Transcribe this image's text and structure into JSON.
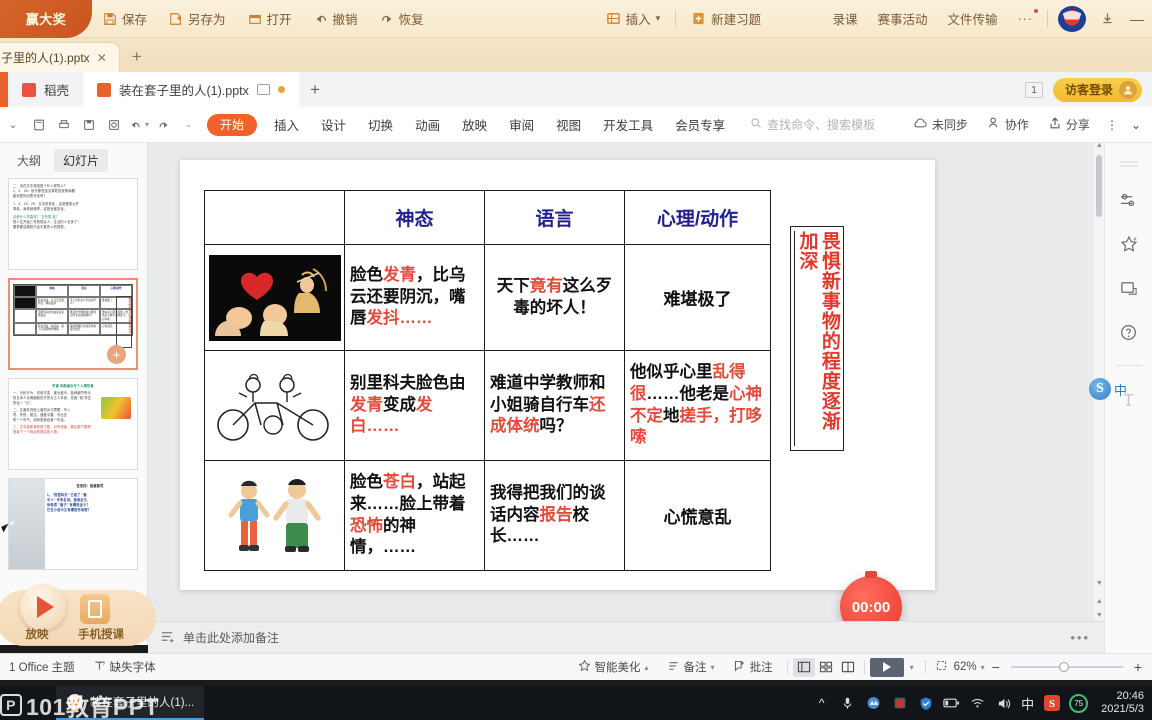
{
  "topbar": {
    "promo": "赢大奖",
    "items": [
      {
        "label": "保存",
        "icon": "save-icon"
      },
      {
        "label": "另存为",
        "icon": "save-as-icon"
      },
      {
        "label": "打开",
        "icon": "open-folder-icon"
      },
      {
        "label": "撤销",
        "icon": "undo-arrow-icon"
      },
      {
        "label": "恢复",
        "icon": "redo-arrow-icon"
      }
    ],
    "insert": {
      "label": "插入",
      "icon": "insert-icon",
      "caret": "▾"
    },
    "new_exercise": {
      "label": "新建习题",
      "icon": "new-exercise-icon"
    },
    "plain_items": [
      "录课",
      "赛事活动",
      "文件传输"
    ],
    "more": "···",
    "minimize": "—"
  },
  "tabstrip": {
    "doc_tab": "子里的人(1).pptx",
    "close": "✕",
    "new_tab": "+"
  },
  "wpsbar": {
    "home_tab": "稻壳",
    "active_tab": "装在套子里的人(1).pptx",
    "new_tab": "+",
    "page_count": "1",
    "login": "访客登录"
  },
  "ribbon": {
    "quick_icons": [
      "new-doc-icon",
      "print-icon",
      "save-doc-icon",
      "print-preview-icon",
      "undo-icon",
      "redo-icon",
      "customize-icon"
    ],
    "tabs": [
      "开始",
      "插入",
      "设计",
      "切换",
      "动画",
      "放映",
      "审阅",
      "视图",
      "开发工具",
      "会员专享"
    ],
    "active_tab": "开始",
    "search_placeholder": "查找命令、搜索模板",
    "right_items": [
      {
        "label": "未同步",
        "icon": "cloud-sync-icon"
      },
      {
        "label": "协作",
        "icon": "collaborate-icon"
      },
      {
        "label": "分享",
        "icon": "share-icon"
      }
    ],
    "overflow": "⋮",
    "collapse": "⌄"
  },
  "left_panel": {
    "tabs": [
      "大纲",
      "幻灯片"
    ],
    "active_tab": "幻灯片",
    "thumbnails": [
      {
        "name": "thumb-question-slide",
        "lines": [
          "二、请在文中找找是个什么样的人？",
          "1、2、48：他令那些连名带姓的犹豫和疑",
          "能到是列出恶可化吗？",
          "7、4、19、29：文中的变化，这是哪类公开",
          "带着，身体就像举，这是全都变化。",
          "这种什么简直样？ 至所需 准？",
          "的人生开始三年的现实人，生活的人去多了！",
          "要重都自典校只会平差的人的感受。"
        ]
      },
      {
        "name": "thumb-table-slide",
        "selected": true,
        "headers": [
          "神态",
          "语言",
          "心理/动作"
        ],
        "cells": [
          [
            "脸色发青，比乌云还要阴沉，嘴唇发抖",
            "天下竟有这么歹毒的坏人！",
            "难堪极了"
          ],
          [
            "别里科夫脸色由发青变成发白",
            "难道中学教师和小姐骑自行车还成体统吗？",
            "他似乎心里乱得很…他老是心神不定地搓手，打哆嗦"
          ],
          [
            "脸色苍白，站起来…脸上带着恐怖的神情",
            "我得把我们的谈话内容报告校长",
            "心慌意乱"
          ]
        ],
        "side_text": "畏惧新事物的程度逐渐加深",
        "add_button": "+"
      },
      {
        "name": "thumb-personal-slide",
        "title": "学请 你能画出写个人物形象",
        "lines": [
          "一、分析行为、衣着不变、被为被马、各种细节所示",
          "的日本人无明细致的方的为之人本身、总指 “吸”学生",
          "的话一 “己”。",
          "二、正面情况他上面的对习惯眼、写入",
          "境、外形、相当、速度平路、写出去",
          "的一个可气，用着是我自身一句话。",
          "三、文中给体现有的习想、对写消极、那见那了那样",
          "现象了一个特点的现实的人悟。"
        ]
      },
      {
        "name": "thumb-task-slide",
        "title": "任务四：拓展探究",
        "lines": [
          "1、\"别里科夫\" 已成了 \"套",
          "中人\" 专有名词。速读全文，",
          "你觉得 \"套子\" 有哪些含义？",
          "它在小说中又有哪些作用呢？"
        ]
      }
    ]
  },
  "slide": {
    "table": {
      "headers": [
        "",
        "神态",
        "语言",
        "心理/动作"
      ],
      "rows": [
        {
          "image": "hearts-cupid-image",
          "shentai": [
            {
              "t": "脸色",
              "c": "black"
            },
            {
              "t": "发青",
              "c": "red"
            },
            {
              "t": "，",
              "c": "black"
            },
            {
              "t": "比乌云还要阴沉，嘴唇",
              "c": "black"
            },
            {
              "t": "发抖",
              "c": "red"
            },
            {
              "t": "……",
              "c": "red"
            }
          ],
          "shentai_plain": "脸色发青，比乌云还要阴沉，嘴唇发抖……",
          "yuyan_plain": "天下竟有这么歹毒的坏人！",
          "xinli_plain": "难堪极了"
        },
        {
          "image": "tandem-bicycle-image",
          "shentai_plain": "别里科夫脸色由发青变成发白……",
          "yuyan_plain": "难道中学教师和小姐骑自行车还成体统吗？",
          "xinli_plain": "他似乎心里乱得很……他老是心神不定地搓手，打哆嗦"
        },
        {
          "image": "two-boys-image",
          "shentai_plain": "脸色苍白，站起来……脸上带着恐怖的神情，……",
          "yuyan_plain": "我得把我们的谈话内容报告校长……",
          "xinli_plain": "心慌意乱"
        }
      ]
    },
    "side_box_text": "畏惧新事物的程度逐渐加深",
    "timer": "00:00"
  },
  "notes": {
    "placeholder": "单击此处添加备注",
    "icon": "notes-icon",
    "more": "•••"
  },
  "status": {
    "theme": "1 Office 主题",
    "missing_font": "缺失字体",
    "beautify": "智能美化",
    "beautify_caret": "▴",
    "notes": "备注",
    "notes_caret": "▾",
    "comments": "批注",
    "view_buttons": [
      "normal-view-icon",
      "slide-sorter-icon",
      "reading-view-icon"
    ],
    "active_view": "normal-view-icon",
    "play": "play-icon",
    "play_caret": "▾",
    "fit_icon": "fit-slide-icon",
    "zoom": "62%",
    "zoom_caret": "▾",
    "minus": "−",
    "plus": "+"
  },
  "right_rail": {
    "icons": [
      "sliders-icon",
      "sparkle-star-icon",
      "picture-frame-icon",
      "help-circle-icon",
      "text-tool-icon"
    ]
  },
  "ime": {
    "logo": "S",
    "mode": "中"
  },
  "presenter": {
    "play_label": "放映",
    "phone_label": "手机授课"
  },
  "watermark": "101教育PPT",
  "taskbar": {
    "app_title": "装在套子里的人(1)...",
    "tray_icons": [
      "chevron-up-icon",
      "microphone-icon",
      "cloud-drive-icon",
      "red-shield-icon",
      "blue-shield-icon",
      "battery-icon",
      "wifi-icon",
      "volume-icon"
    ],
    "ime_label": "中",
    "sogou": "S",
    "battery_pct": "75",
    "time": "20:46",
    "date": "2021/5/3"
  },
  "colors": {
    "accent_orange": "#f0612c",
    "header_blue": "#22228c",
    "highlight_red": "#e24b3c",
    "side_red": "#e03a2f",
    "topbar_bg": "#f7e9cd",
    "taskbar_bg": "#111418"
  }
}
